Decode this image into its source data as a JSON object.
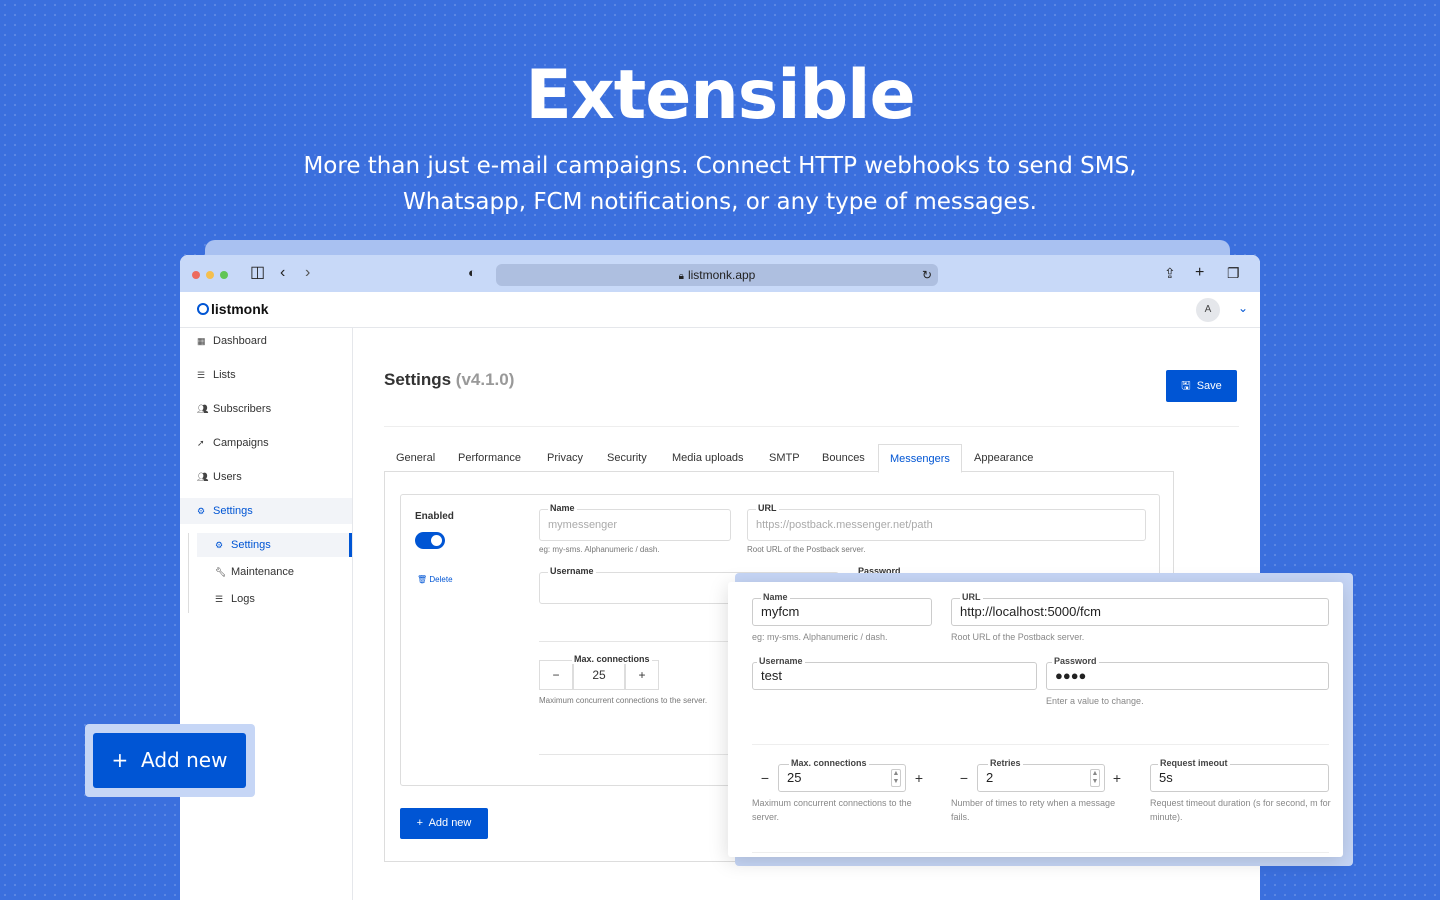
{
  "hero": {
    "title": "Extensible",
    "subtitle": "More than just e-mail campaigns. Connect HTTP webhooks to send SMS, Whatsapp, FCM notifications, or any type of messages."
  },
  "browser": {
    "url": "listmonk.app"
  },
  "app": {
    "logo": "listmonk",
    "avatar": "A",
    "nav": [
      {
        "label": "Dashboard",
        "icon": "dashboard-icon"
      },
      {
        "label": "Lists",
        "icon": "list-icon"
      },
      {
        "label": "Subscribers",
        "icon": "users-icon"
      },
      {
        "label": "Campaigns",
        "icon": "rocket-icon"
      },
      {
        "label": "Users",
        "icon": "users-icon"
      },
      {
        "label": "Settings",
        "icon": "gear-icon"
      }
    ],
    "subnav": [
      {
        "label": "Settings",
        "icon": "gear-icon"
      },
      {
        "label": "Maintenance",
        "icon": "wrench-icon"
      },
      {
        "label": "Logs",
        "icon": "list-icon"
      }
    ]
  },
  "page": {
    "title": "Settings",
    "version": "(v4.1.0)",
    "save_label": "Save",
    "tabs": [
      "General",
      "Performance",
      "Privacy",
      "Security",
      "Media uploads",
      "SMTP",
      "Bounces",
      "Messengers",
      "Appearance"
    ],
    "active_tab": "Messengers"
  },
  "messenger1": {
    "enabled_label": "Enabled",
    "enabled": true,
    "delete_label": "Delete",
    "name_label": "Name",
    "name_placeholder": "mymessenger",
    "name_help": "eg: my-sms. Alphanumeric / dash.",
    "url_label": "URL",
    "url_placeholder": "https://postback.messenger.net/path",
    "url_help": "Root URL of the Postback server.",
    "username_label": "Username",
    "password_label": "Password",
    "maxconn_label": "Max. connections",
    "maxconn_value": "25",
    "maxconn_help": "Maximum concurrent connections to the server.",
    "add_new_label": "Add new"
  },
  "messenger2": {
    "name_label": "Name",
    "name_value": "myfcm",
    "name_help": "eg: my-sms. Alphanumeric / dash.",
    "url_label": "URL",
    "url_value": "http://localhost:5000/fcm",
    "url_help": "Root URL of the Postback server.",
    "username_label": "Username",
    "username_value": "test",
    "password_label": "Password",
    "password_value": "●●●●",
    "password_help": "Enter a value to change.",
    "maxconn_label": "Max. connections",
    "maxconn_value": "25",
    "maxconn_help": "Maximum concurrent connections to the server.",
    "retries_label": "Retries",
    "retries_value": "2",
    "retries_help": "Number of times to rety when a message fails.",
    "timeout_label": "Request imeout",
    "timeout_value": "5s",
    "timeout_help": "Request timeout duration (s for second, m for minute)."
  },
  "floating": {
    "add_new_label": "Add new"
  },
  "colors": {
    "background": "#3b6fdd",
    "accent": "#0055d4"
  }
}
